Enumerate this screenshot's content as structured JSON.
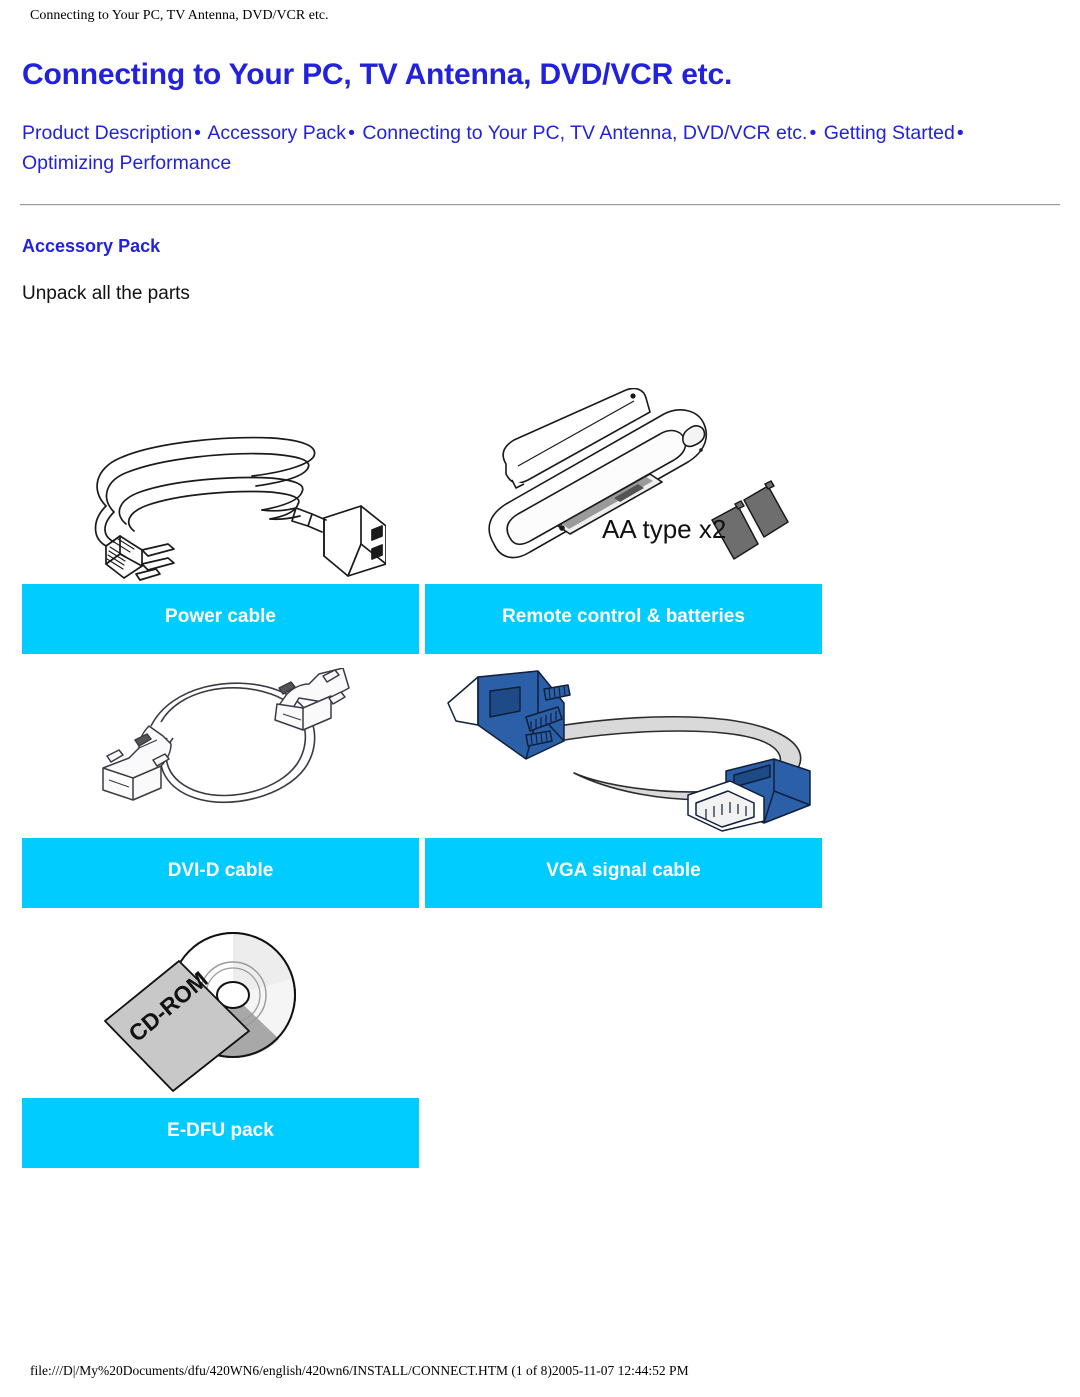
{
  "print": {
    "header": "Connecting to Your PC, TV Antenna, DVD/VCR etc.",
    "footer": "file:///D|/My%20Documents/dfu/420WN6/english/420wn6/INSTALL/CONNECT.HTM (1 of 8)2005-11-07 12:44:52 PM"
  },
  "page": {
    "title": "Connecting to Your PC, TV Antenna, DVD/VCR etc.",
    "nav": {
      "separator": "•",
      "links": [
        "Product Description",
        "Accessory Pack",
        "Connecting to Your PC, TV Antenna, DVD/VCR etc.",
        "Getting Started",
        "Optimizing Performance"
      ]
    },
    "section": {
      "heading": "Accessory Pack",
      "intro": "Unpack all the parts"
    }
  },
  "accessories": [
    {
      "caption": "Power cable",
      "figure": "power-cable-illustration"
    },
    {
      "caption": "Remote control & batteries",
      "figure": "remote-control-illustration",
      "figure_label": "AA type x2"
    },
    {
      "caption": "DVI-D cable",
      "figure": "dvi-d-cable-illustration"
    },
    {
      "caption": "VGA signal cable",
      "figure": "vga-cable-illustration"
    },
    {
      "caption": "E-DFU pack",
      "figure": "cd-rom-illustration",
      "figure_label": "CD-ROM"
    }
  ],
  "colors": {
    "link": "#2222dd",
    "caption_bg": "#00ccff",
    "caption_text": "#ffffff",
    "vga_connector": "#2b5fa8",
    "battery": "#6e6e6e",
    "cd_sleeve": "#c8c8c8"
  }
}
